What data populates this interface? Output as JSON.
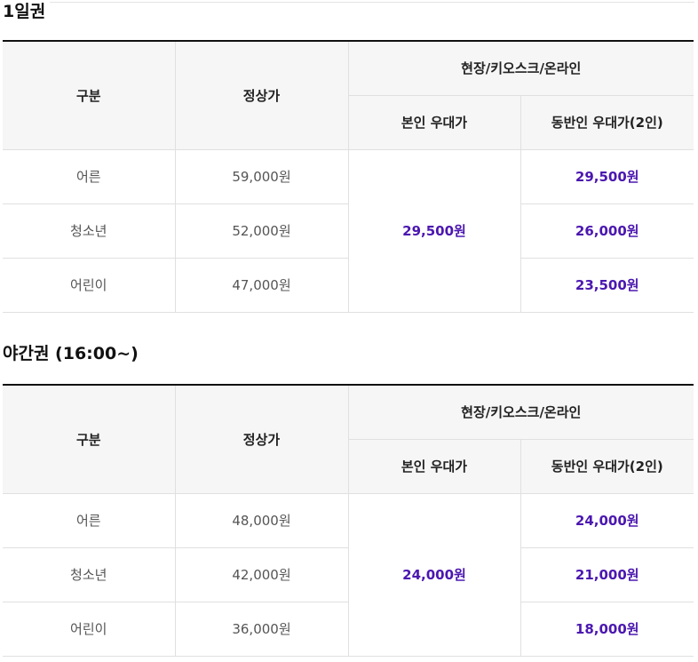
{
  "sections": [
    {
      "title": "1일권",
      "headers": {
        "category": "구분",
        "regular_price": "정상가",
        "channel": "현장/키오스크/온라인",
        "self_discount": "본인 우대가",
        "companion_discount": "동반인 우대가(2인)"
      },
      "self_discount_price": "29,500원",
      "rows": [
        {
          "category": "어른",
          "regular_price": "59,000원",
          "companion_price": "29,500원"
        },
        {
          "category": "청소년",
          "regular_price": "52,000원",
          "companion_price": "26,000원"
        },
        {
          "category": "어린이",
          "regular_price": "47,000원",
          "companion_price": "23,500원"
        }
      ]
    },
    {
      "title": "야간권 (16:00~)",
      "headers": {
        "category": "구분",
        "regular_price": "정상가",
        "channel": "현장/키오스크/온라인",
        "self_discount": "본인 우대가",
        "companion_discount": "동반인 우대가(2인)"
      },
      "self_discount_price": "24,000원",
      "rows": [
        {
          "category": "어른",
          "regular_price": "48,000원",
          "companion_price": "24,000원"
        },
        {
          "category": "청소년",
          "regular_price": "42,000원",
          "companion_price": "21,000원"
        },
        {
          "category": "어린이",
          "regular_price": "36,000원",
          "companion_price": "18,000원"
        }
      ]
    }
  ],
  "colors": {
    "accent_price": "#4b17b0",
    "header_bg": "#f6f6f6",
    "table_top_border": "#111111",
    "grid_line": "#e0e0e0"
  }
}
